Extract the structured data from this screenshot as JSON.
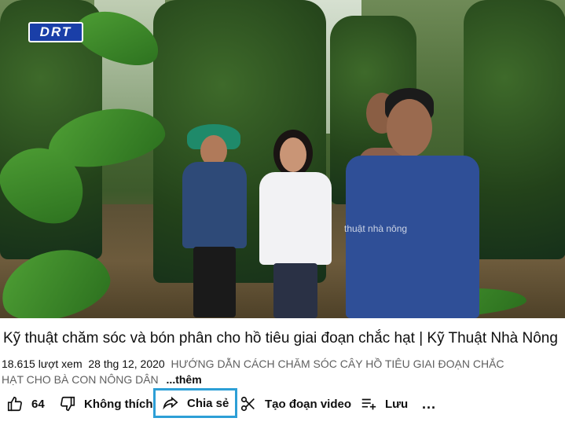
{
  "video": {
    "channel_logo_text": "DRT",
    "watermark": "thuật nhà nông",
    "title": "Kỹ thuật chăm sóc và bón phân cho hồ tiêu giai đoạn chắc hạt | Kỹ Thuật Nhà Nông",
    "views": "18.615 lượt xem",
    "date": "28 thg 12, 2020",
    "description_line1": "HƯỚNG DẪN CÁCH CHĂM SÓC CÂY HỒ TIÊU GIAI ĐOẠN CHẮC",
    "description_line2": "HẠT CHO BÀ CON NÔNG DÂN",
    "more_label": "...thêm"
  },
  "actions": {
    "like_count": "64",
    "dislike_label": "Không thích",
    "share_label": "Chia sẻ",
    "clip_label": "Tạo đoạn video",
    "save_label": "Lưu",
    "more_label": "..."
  },
  "colors": {
    "share_highlight": "#2d9fd6",
    "logo_bg": "#1a3fa8"
  }
}
